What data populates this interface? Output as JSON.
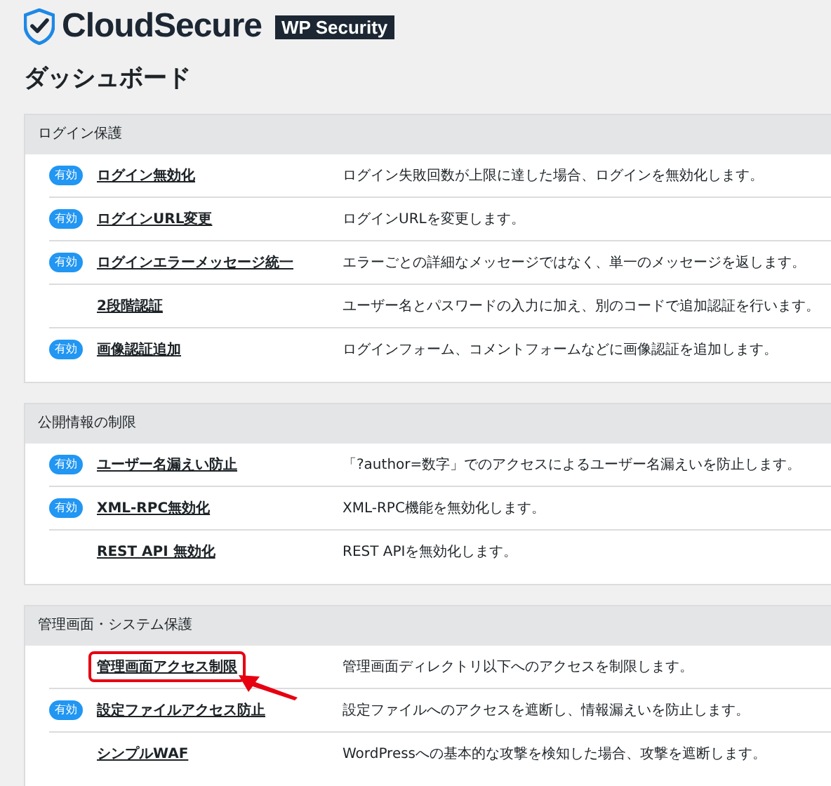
{
  "brand": {
    "name": "CloudSecure",
    "tag": "WP Security"
  },
  "page_title": "ダッシュボード",
  "sections": [
    {
      "title": "ログイン保護",
      "items": [
        {
          "badge": "有効",
          "enabled": true,
          "label": "ログイン無効化",
          "description": "ログイン失敗回数が上限に達した場合、ログインを無効化します。",
          "highlighted": false
        },
        {
          "badge": "有効",
          "enabled": true,
          "label": "ログインURL変更",
          "description": "ログインURLを変更します。",
          "highlighted": false
        },
        {
          "badge": "有効",
          "enabled": true,
          "label": "ログインエラーメッセージ統一",
          "description": "エラーごとの詳細なメッセージではなく、単一のメッセージを返します。",
          "highlighted": false
        },
        {
          "enabled": false,
          "label": "2段階認証",
          "description": "ユーザー名とパスワードの入力に加え、別のコードで追加認証を行います。",
          "highlighted": false
        },
        {
          "badge": "有効",
          "enabled": true,
          "label": "画像認証追加",
          "description": "ログインフォーム、コメントフォームなどに画像認証を追加します。",
          "highlighted": false
        }
      ]
    },
    {
      "title": "公開情報の制限",
      "items": [
        {
          "badge": "有効",
          "enabled": true,
          "label": "ユーザー名漏えい防止",
          "description": "「?author=数字」でのアクセスによるユーザー名漏えいを防止します。",
          "highlighted": false
        },
        {
          "badge": "有効",
          "enabled": true,
          "label": "XML-RPC無効化",
          "description": "XML-RPC機能を無効化します。",
          "highlighted": false
        },
        {
          "enabled": false,
          "label": "REST API 無効化",
          "description": "REST APIを無効化します。",
          "highlighted": false
        }
      ]
    },
    {
      "title": "管理画面・システム保護",
      "items": [
        {
          "enabled": false,
          "label": "管理画面アクセス制限",
          "description": "管理画面ディレクトリ以下へのアクセスを制限します。",
          "highlighted": true
        },
        {
          "badge": "有効",
          "enabled": true,
          "label": "設定ファイルアクセス防止",
          "description": "設定ファイルへのアクセスを遮断し、情報漏えいを防止します。",
          "highlighted": false
        },
        {
          "enabled": false,
          "label": "シンプルWAF",
          "description": "WordPressへの基本的な攻撃を検知した場合、攻撃を遮断します。",
          "highlighted": false
        }
      ]
    }
  ]
}
